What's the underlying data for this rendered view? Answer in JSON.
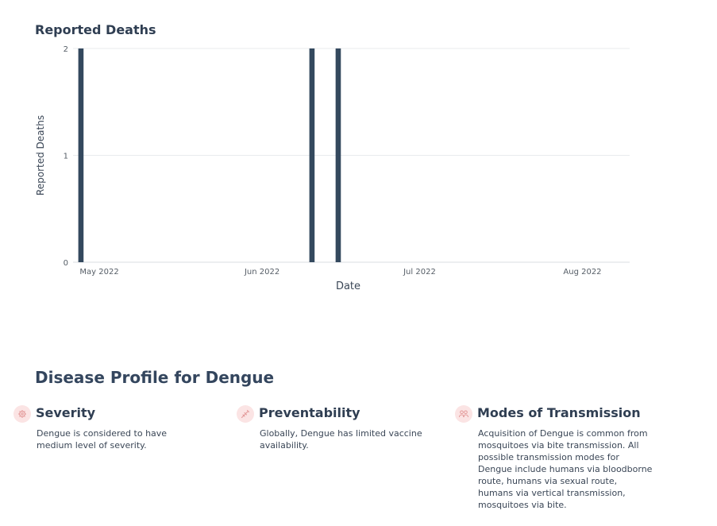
{
  "chart_data": {
    "type": "bar",
    "title": "Reported Deaths",
    "xlabel": "Date",
    "ylabel": "Reported Deaths",
    "x_ticks": [
      "May 2022",
      "Jun 2022",
      "Jul 2022",
      "Aug 2022"
    ],
    "x_tick_dates": [
      "2022-05-01",
      "2022-06-01",
      "2022-07-01",
      "2022-08-01"
    ],
    "xlim": [
      "2022-04-26",
      "2022-08-10"
    ],
    "y_ticks": [
      0,
      1,
      2
    ],
    "ylim": [
      0,
      2
    ],
    "grid": true,
    "color": "#34495e",
    "x": [
      "2022-04-27",
      "2022-06-10",
      "2022-06-15"
    ],
    "values": [
      2,
      2,
      2
    ]
  },
  "profile": {
    "title": "Disease Profile for Dengue",
    "cards": [
      {
        "icon": "severity-gear-icon",
        "heading": "Severity",
        "body": "Dengue is considered to have medium level of severity."
      },
      {
        "icon": "syringe-icon",
        "heading": "Preventability",
        "body": "Globally, Dengue has limited vaccine availability."
      },
      {
        "icon": "people-icon",
        "heading": "Modes of Transmission",
        "body": "Acquisition of Dengue is common from mosquitoes via bite transmission. All possible transmission modes for Dengue include humans via bloodborne route, humans via sexual route, humans via vertical transmission, mosquitoes via bite."
      }
    ]
  }
}
